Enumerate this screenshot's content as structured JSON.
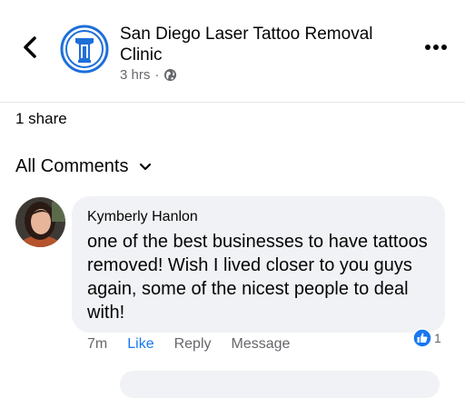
{
  "post": {
    "page_name": "San Diego Laser Tattoo Removal Clinic",
    "time": "3 hrs",
    "separator": "·",
    "audience_icon": "globe-icon"
  },
  "icons": {
    "back": "chevron-left-icon",
    "more": "more-horizontal-icon",
    "sort": "chevron-down-icon"
  },
  "colors": {
    "brand_blue": "#1877f2",
    "logo_blue": "#1e6fd9",
    "bubble_bg": "#f0f2f5",
    "secondary_text": "#65676b"
  },
  "stats": {
    "shares": "1 share"
  },
  "comments": {
    "header": "All Comments",
    "items": [
      {
        "author": "Kymberly Hanlon",
        "text": "one of the best businesses to have tattoos removed! Wish I lived closer to you guys again, some of the nicest people to deal with!",
        "time": "7m",
        "like_label": "Like",
        "reply_label": "Reply",
        "message_label": "Message",
        "reaction_icon": "thumbs-up-icon",
        "reaction_count": "1"
      }
    ]
  }
}
